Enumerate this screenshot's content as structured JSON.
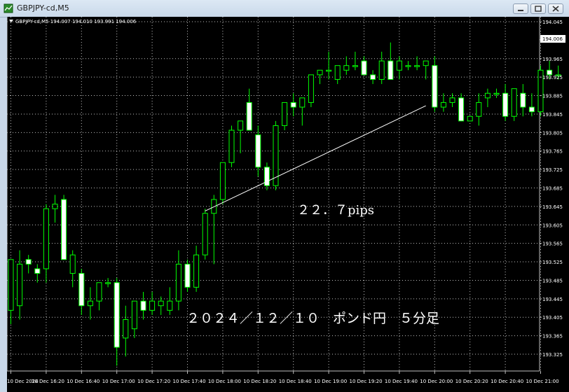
{
  "window": {
    "title": "GBPJPY-cd,M5",
    "icon": "chart-window-icon"
  },
  "chart": {
    "header": "GBPJPY-cd,M5  194.007 194.010 193.991 194.006",
    "current_price": "194.006",
    "pips_annotation": "２２．７pips",
    "caption": "２０２４／１２／１０　ポンド円　５分足",
    "colors": {
      "background": "#000000",
      "grid": "#c0c0c0",
      "bull": "#00ff00",
      "bear": "#ffffff",
      "trendline": "#ffffff"
    }
  },
  "chart_data": {
    "type": "candlestick",
    "symbol": "GBPJPY-cd",
    "timeframe": "M5",
    "title": "GBPJPY-cd,M5",
    "ylim": [
      193.285,
      194.065
    ],
    "y_ticks": [
      "194.045",
      "194.006",
      "193.965",
      "193.925",
      "193.885",
      "193.845",
      "193.805",
      "193.765",
      "193.725",
      "193.685",
      "193.645",
      "193.605",
      "193.565",
      "193.525",
      "193.485",
      "193.445",
      "193.405",
      "193.365",
      "193.325"
    ],
    "x_ticks": [
      "10 Dec 2024",
      "10 Dec 16:20",
      "10 Dec 16:40",
      "10 Dec 17:00",
      "10 Dec 17:20",
      "10 Dec 17:40",
      "10 Dec 18:00",
      "10 Dec 18:20",
      "10 Dec 18:40",
      "10 Dec 19:00",
      "10 Dec 19:20",
      "10 Dec 19:40",
      "10 Dec 20:00",
      "10 Dec 20:20",
      "10 Dec 20:40",
      "10 Dec 21:00"
    ],
    "grid": true,
    "candles": [
      {
        "o": 193.42,
        "h": 193.52,
        "l": 193.39,
        "c": 193.53
      },
      {
        "o": 193.43,
        "h": 193.55,
        "l": 193.4,
        "c": 193.52
      },
      {
        "o": 193.53,
        "h": 193.54,
        "l": 193.5,
        "c": 193.52
      },
      {
        "o": 193.51,
        "h": 193.52,
        "l": 193.48,
        "c": 193.5
      },
      {
        "o": 193.51,
        "h": 193.65,
        "l": 193.48,
        "c": 193.64
      },
      {
        "o": 193.64,
        "h": 193.67,
        "l": 193.61,
        "c": 193.65
      },
      {
        "o": 193.66,
        "h": 193.67,
        "l": 193.56,
        "c": 193.53
      },
      {
        "o": 193.5,
        "h": 193.55,
        "l": 193.47,
        "c": 193.54
      },
      {
        "o": 193.5,
        "h": 193.51,
        "l": 193.41,
        "c": 193.43
      },
      {
        "o": 193.43,
        "h": 193.47,
        "l": 193.4,
        "c": 193.44
      },
      {
        "o": 193.44,
        "h": 193.48,
        "l": 193.42,
        "c": 193.48
      },
      {
        "o": 193.48,
        "h": 193.49,
        "l": 193.47,
        "c": 193.48
      },
      {
        "o": 193.48,
        "h": 193.49,
        "l": 193.3,
        "c": 193.34
      },
      {
        "o": 193.36,
        "h": 193.43,
        "l": 193.32,
        "c": 193.4
      },
      {
        "o": 193.38,
        "h": 193.44,
        "l": 193.36,
        "c": 193.44
      },
      {
        "o": 193.44,
        "h": 193.46,
        "l": 193.4,
        "c": 193.42
      },
      {
        "o": 193.42,
        "h": 193.46,
        "l": 193.41,
        "c": 193.44
      },
      {
        "o": 193.43,
        "h": 193.45,
        "l": 193.41,
        "c": 193.44
      },
      {
        "o": 193.42,
        "h": 193.47,
        "l": 193.41,
        "c": 193.44
      },
      {
        "o": 193.44,
        "h": 193.55,
        "l": 193.42,
        "c": 193.52
      },
      {
        "o": 193.52,
        "h": 193.53,
        "l": 193.46,
        "c": 193.47
      },
      {
        "o": 193.47,
        "h": 193.56,
        "l": 193.46,
        "c": 193.54
      },
      {
        "o": 193.54,
        "h": 193.64,
        "l": 193.53,
        "c": 193.63
      },
      {
        "o": 193.63,
        "h": 193.67,
        "l": 193.52,
        "c": 193.66
      },
      {
        "o": 193.66,
        "h": 193.74,
        "l": 193.65,
        "c": 193.74
      },
      {
        "o": 193.74,
        "h": 193.82,
        "l": 193.73,
        "c": 193.81
      },
      {
        "o": 193.81,
        "h": 193.83,
        "l": 193.76,
        "c": 193.83
      },
      {
        "o": 193.87,
        "h": 193.9,
        "l": 193.84,
        "c": 193.81
      },
      {
        "o": 193.8,
        "h": 193.82,
        "l": 193.71,
        "c": 193.73
      },
      {
        "o": 193.73,
        "h": 193.74,
        "l": 193.68,
        "c": 193.69
      },
      {
        "o": 193.69,
        "h": 193.83,
        "l": 193.68,
        "c": 193.82
      },
      {
        "o": 193.82,
        "h": 193.87,
        "l": 193.81,
        "c": 193.87
      },
      {
        "o": 193.87,
        "h": 193.89,
        "l": 193.84,
        "c": 193.86
      },
      {
        "o": 193.86,
        "h": 193.88,
        "l": 193.82,
        "c": 193.88
      },
      {
        "o": 193.87,
        "h": 193.93,
        "l": 193.86,
        "c": 193.93
      },
      {
        "o": 193.93,
        "h": 193.94,
        "l": 193.91,
        "c": 193.94
      },
      {
        "o": 193.94,
        "h": 193.98,
        "l": 193.92,
        "c": 193.94
      },
      {
        "o": 193.92,
        "h": 193.95,
        "l": 193.91,
        "c": 193.95
      },
      {
        "o": 193.94,
        "h": 193.97,
        "l": 193.93,
        "c": 193.95
      },
      {
        "o": 193.95,
        "h": 193.98,
        "l": 193.94,
        "c": 193.95
      },
      {
        "o": 193.96,
        "h": 193.97,
        "l": 193.93,
        "c": 193.93
      },
      {
        "o": 193.93,
        "h": 193.94,
        "l": 193.91,
        "c": 193.92
      },
      {
        "o": 193.92,
        "h": 193.98,
        "l": 193.91,
        "c": 193.96
      },
      {
        "o": 193.96,
        "h": 194.0,
        "l": 193.95,
        "c": 193.92
      },
      {
        "o": 193.94,
        "h": 193.97,
        "l": 193.92,
        "c": 193.96
      },
      {
        "o": 193.95,
        "h": 193.96,
        "l": 193.94,
        "c": 193.95
      },
      {
        "o": 193.95,
        "h": 193.97,
        "l": 193.94,
        "c": 193.95
      },
      {
        "o": 193.95,
        "h": 193.96,
        "l": 193.92,
        "c": 193.96
      },
      {
        "o": 193.95,
        "h": 193.97,
        "l": 193.85,
        "c": 193.86
      },
      {
        "o": 193.86,
        "h": 193.89,
        "l": 193.85,
        "c": 193.87
      },
      {
        "o": 193.87,
        "h": 193.89,
        "l": 193.86,
        "c": 193.88
      },
      {
        "o": 193.88,
        "h": 193.89,
        "l": 193.83,
        "c": 193.83
      },
      {
        "o": 193.83,
        "h": 193.84,
        "l": 193.83,
        "c": 193.84
      },
      {
        "o": 193.84,
        "h": 193.89,
        "l": 193.82,
        "c": 193.87
      },
      {
        "o": 193.88,
        "h": 193.9,
        "l": 193.86,
        "c": 193.89
      },
      {
        "o": 193.89,
        "h": 193.9,
        "l": 193.88,
        "c": 193.89
      },
      {
        "o": 193.89,
        "h": 193.91,
        "l": 193.83,
        "c": 193.84
      },
      {
        "o": 193.84,
        "h": 193.9,
        "l": 193.83,
        "c": 193.9
      },
      {
        "o": 193.89,
        "h": 193.91,
        "l": 193.84,
        "c": 193.86
      },
      {
        "o": 193.86,
        "h": 193.89,
        "l": 193.84,
        "c": 193.85
      },
      {
        "o": 193.85,
        "h": 193.95,
        "l": 193.84,
        "c": 193.94
      },
      {
        "o": 193.94,
        "h": 193.96,
        "l": 193.92,
        "c": 193.93
      },
      {
        "o": 193.93,
        "h": 193.95,
        "l": 193.92,
        "c": 193.93
      }
    ],
    "trendline": {
      "from": {
        "candle": 22,
        "price": 193.635
      },
      "to": {
        "candle": 47,
        "price": 193.863
      }
    }
  }
}
